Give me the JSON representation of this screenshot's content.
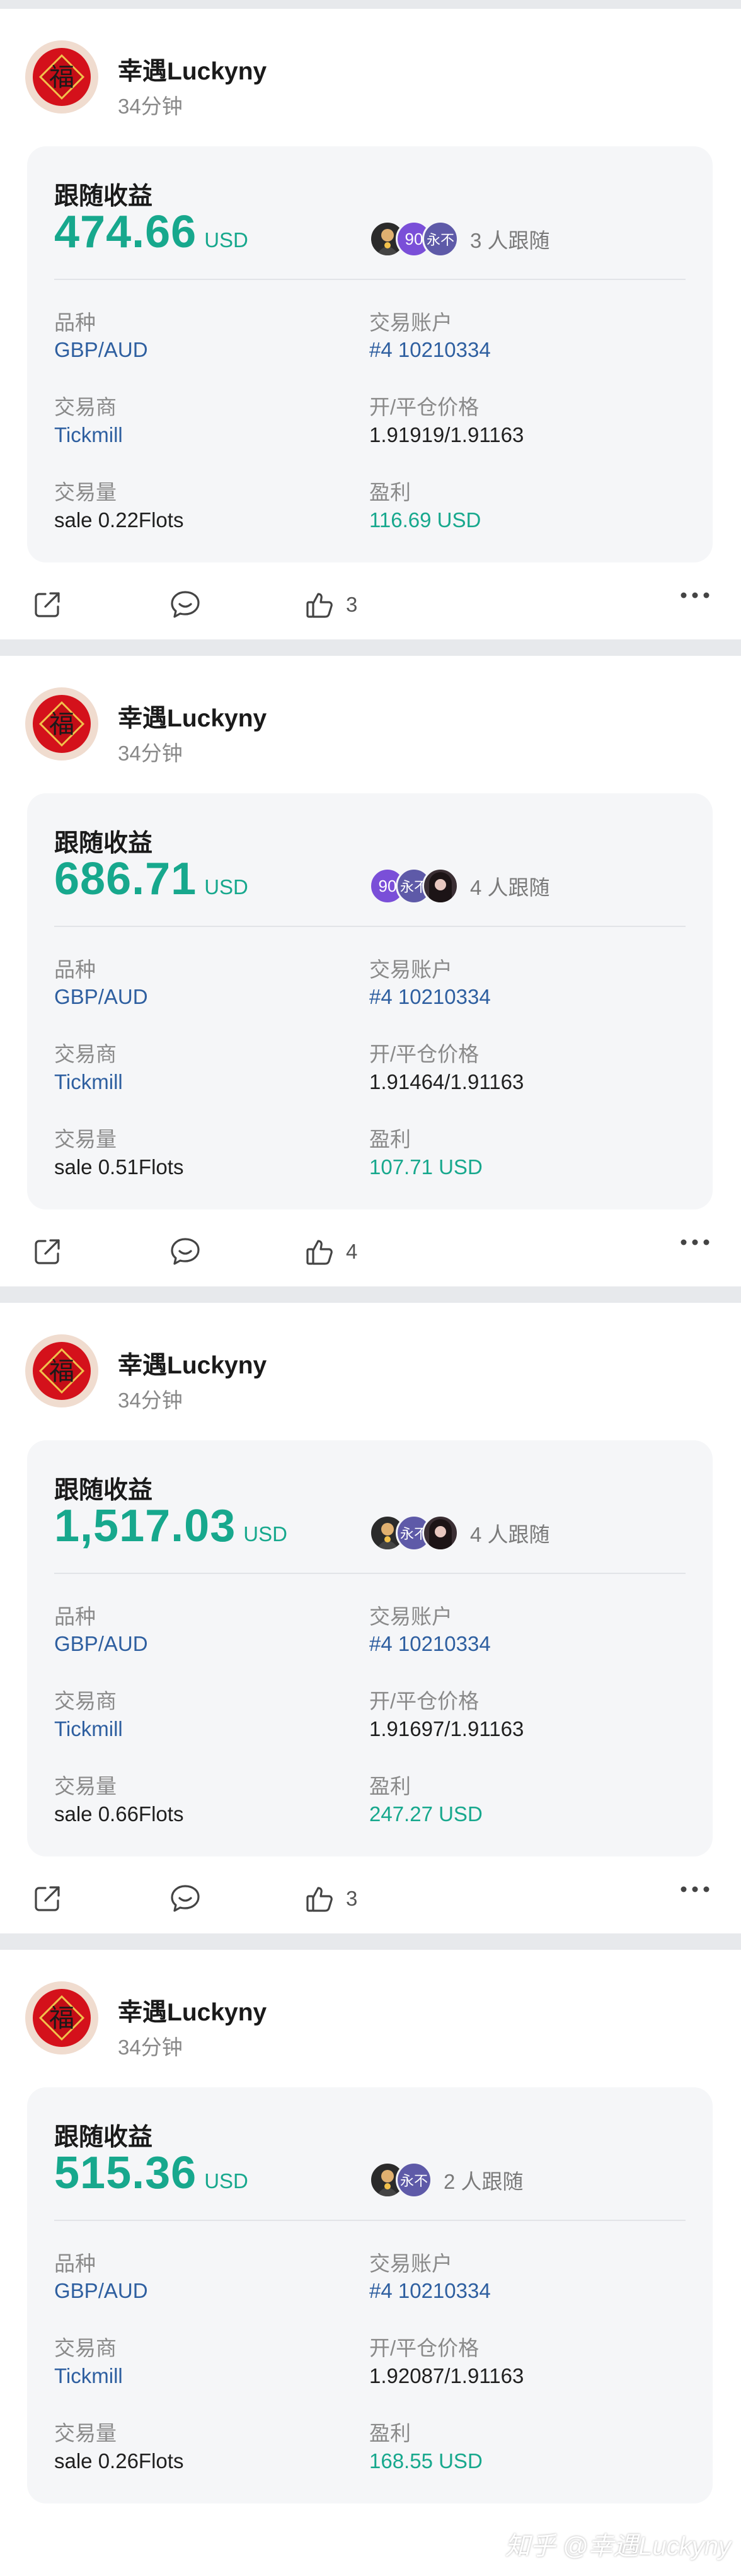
{
  "posts": [
    {
      "user": "幸遇Luckyny",
      "time": "34分钟",
      "card": {
        "title": "跟随收益",
        "amount": "474.66",
        "unit": "USD",
        "followers_text": "3 人跟随",
        "rows": {
          "variety_label": "品种",
          "variety": "GBP/AUD",
          "account_label": "交易账户",
          "account": "#4 10210334",
          "broker_label": "交易商",
          "broker": "Tickmill",
          "price_label": "开/平仓价格",
          "price": "1.91919/1.91163",
          "volume_label": "交易量",
          "volume": "sale 0.22Flots",
          "profit_label": "盈利",
          "profit": "116.69 USD"
        }
      },
      "likes": "3"
    },
    {
      "user": "幸遇Luckyny",
      "time": "34分钟",
      "card": {
        "title": "跟随收益",
        "amount": "686.71",
        "unit": "USD",
        "followers_text": "4 人跟随",
        "rows": {
          "variety_label": "品种",
          "variety": "GBP/AUD",
          "account_label": "交易账户",
          "account": "#4 10210334",
          "broker_label": "交易商",
          "broker": "Tickmill",
          "price_label": "开/平仓价格",
          "price": "1.91464/1.91163",
          "volume_label": "交易量",
          "volume": "sale 0.51Flots",
          "profit_label": "盈利",
          "profit": "107.71 USD"
        }
      },
      "likes": "4"
    },
    {
      "user": "幸遇Luckyny",
      "time": "34分钟",
      "card": {
        "title": "跟随收益",
        "amount": "1,517.03",
        "unit": "USD",
        "followers_text": "4 人跟随",
        "rows": {
          "variety_label": "品种",
          "variety": "GBP/AUD",
          "account_label": "交易账户",
          "account": "#4 10210334",
          "broker_label": "交易商",
          "broker": "Tickmill",
          "price_label": "开/平仓价格",
          "price": "1.91697/1.91163",
          "volume_label": "交易量",
          "volume": "sale 0.66Flots",
          "profit_label": "盈利",
          "profit": "247.27 USD"
        }
      },
      "likes": "3"
    },
    {
      "user": "幸遇Luckyny",
      "time": "34分钟",
      "card": {
        "title": "跟随收益",
        "amount": "515.36",
        "unit": "USD",
        "followers_text": "2 人跟随",
        "rows": {
          "variety_label": "品种",
          "variety": "GBP/AUD",
          "account_label": "交易账户",
          "account": "#4 10210334",
          "broker_label": "交易商",
          "broker": "Tickmill",
          "price_label": "开/平仓价格",
          "price": "1.92087/1.91163",
          "volume_label": "交易量",
          "volume": "sale 0.26Flots",
          "profit_label": "盈利",
          "profit": "168.55 USD"
        }
      },
      "likes": ""
    }
  ],
  "avatar_badges": {
    "num": "90",
    "yong": "永不"
  },
  "icons": [
    "share-icon",
    "comment-icon",
    "like-icon",
    "more-icon"
  ],
  "colors": {
    "accent_green": "#17a88d",
    "link_blue": "#2e5fa0",
    "separator": "#e7e9ec"
  },
  "watermark": "知乎 @幸遇Luckyny"
}
